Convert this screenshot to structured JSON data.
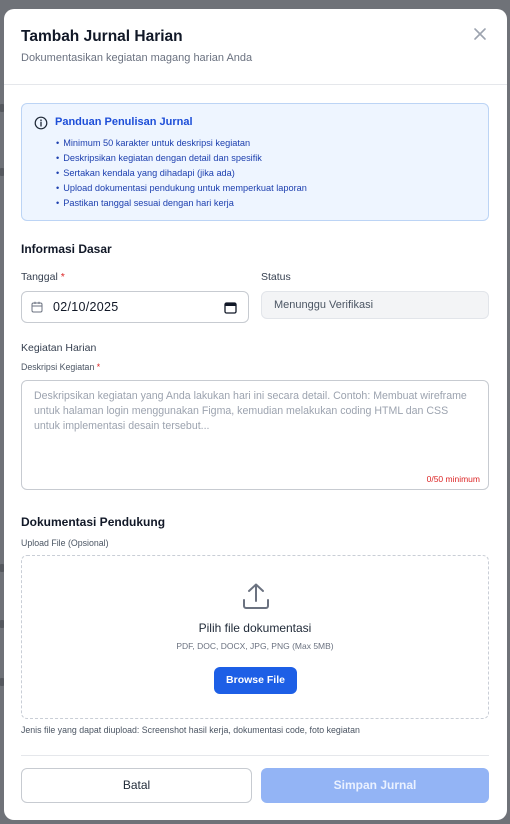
{
  "modal": {
    "title": "Tambah Jurnal Harian",
    "subtitle": "Dokumentasikan kegiatan magang harian Anda",
    "close_icon": "close-icon"
  },
  "guide": {
    "icon": "info-icon",
    "title": "Panduan Penulisan Jurnal",
    "items": [
      "Minimum 50 karakter untuk deskripsi kegiatan",
      "Deskripsikan kegiatan dengan detail dan spesifik",
      "Sertakan kendala yang dihadapi (jika ada)",
      "Upload dokumentasi pendukung untuk memperkuat laporan",
      "Pastikan tanggal sesuai dengan hari kerja"
    ]
  },
  "basic_info": {
    "section_title": "Informasi Dasar",
    "date_label": "Tanggal",
    "required_mark": "*",
    "date_value": "02/10/2025",
    "status_label": "Status",
    "status_value": "Menunggu Verifikasi"
  },
  "activity": {
    "section_title": "Kegiatan Harian",
    "description_label": "Deskripsi Kegiatan",
    "required_mark": "*",
    "placeholder": "Deskripsikan kegiatan yang Anda lakukan hari ini secara detail. Contoh: Membuat wireframe untuk halaman login menggunakan Figma, kemudian melakukan coding HTML dan CSS untuk implementasi desain tersebut...",
    "value": "",
    "counter": "0/50 minimum"
  },
  "documentation": {
    "section_title": "Dokumentasi Pendukung",
    "upload_label": "Upload File (Opsional)",
    "upload_icon": "upload-icon",
    "drop_title": "Pilih file dokumentasi",
    "drop_types": "PDF, DOC, DOCX, JPG, PNG (Max 5MB)",
    "browse_label": "Browse File",
    "hint": "Jenis file yang dapat diupload: Screenshot hasil kerja, dokumentasi code, foto kegiatan"
  },
  "footer": {
    "cancel_label": "Batal",
    "save_label": "Simpan Jurnal"
  },
  "colors": {
    "primary": "#1d5fe6",
    "primary_disabled": "#93b4f5",
    "required": "#dc2626",
    "info_bg": "#eef5ff",
    "info_text": "#1e40af"
  }
}
